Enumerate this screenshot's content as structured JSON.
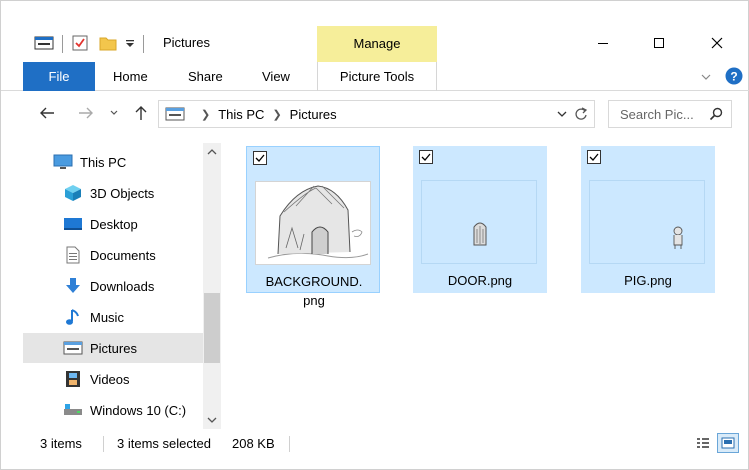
{
  "window": {
    "title": "Pictures",
    "context_tab": "Manage",
    "accent_color": "#1f6fc5",
    "manage_color": "#f6ee9a",
    "selection_color": "#cce8ff"
  },
  "ribbon": {
    "file_label": "File",
    "tabs": [
      "Home",
      "Share",
      "View"
    ],
    "picture_tools_label": "Picture Tools"
  },
  "address": {
    "crumbs": [
      "This PC",
      "Pictures"
    ],
    "search_placeholder": "Search Pic..."
  },
  "sidebar": {
    "items": [
      {
        "label": "This PC",
        "icon": "computer-icon"
      },
      {
        "label": "3D Objects",
        "icon": "cube-icon"
      },
      {
        "label": "Desktop",
        "icon": "desktop-icon"
      },
      {
        "label": "Documents",
        "icon": "document-icon"
      },
      {
        "label": "Downloads",
        "icon": "download-arrow-icon"
      },
      {
        "label": "Music",
        "icon": "music-note-icon"
      },
      {
        "label": "Pictures",
        "icon": "pictures-icon"
      },
      {
        "label": "Videos",
        "icon": "film-icon"
      },
      {
        "label": "Windows 10 (C:)",
        "icon": "drive-icon"
      }
    ],
    "current": "Pictures"
  },
  "files": [
    {
      "name": "BACKGROUND.png",
      "checked": true
    },
    {
      "name": "DOOR.png",
      "checked": true
    },
    {
      "name": "PIG.png",
      "checked": true
    }
  ],
  "status": {
    "item_count": "3 items",
    "selected": "3 items selected",
    "size": "208 KB"
  }
}
